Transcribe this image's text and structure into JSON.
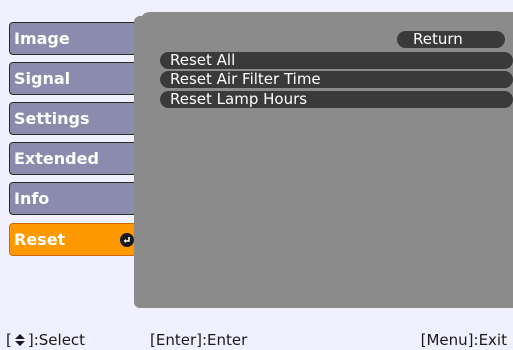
{
  "sidebar": {
    "items": [
      {
        "label": "Image"
      },
      {
        "label": "Signal"
      },
      {
        "label": "Settings"
      },
      {
        "label": "Extended"
      },
      {
        "label": "Info"
      },
      {
        "label": "Reset",
        "active": true
      }
    ]
  },
  "main": {
    "return_label": "Return",
    "items": [
      {
        "label": "Reset All"
      },
      {
        "label": "Reset Air Filter Time"
      },
      {
        "label": "Reset Lamp Hours"
      }
    ]
  },
  "footer": {
    "select_open": "[",
    "select_close": "]",
    "select_label": ":Select",
    "enter_hint": "[Enter]:Enter",
    "exit_hint": "[Menu]:Exit"
  },
  "colors": {
    "active_tab": "#ff9900",
    "tab": "#8b8cad",
    "panel": "#8b8b8b",
    "pill": "#3a3a3a",
    "background": "#f0f0ff"
  },
  "icons": {
    "enter": "enter-return-icon",
    "select": "up-down-arrow-icon"
  }
}
